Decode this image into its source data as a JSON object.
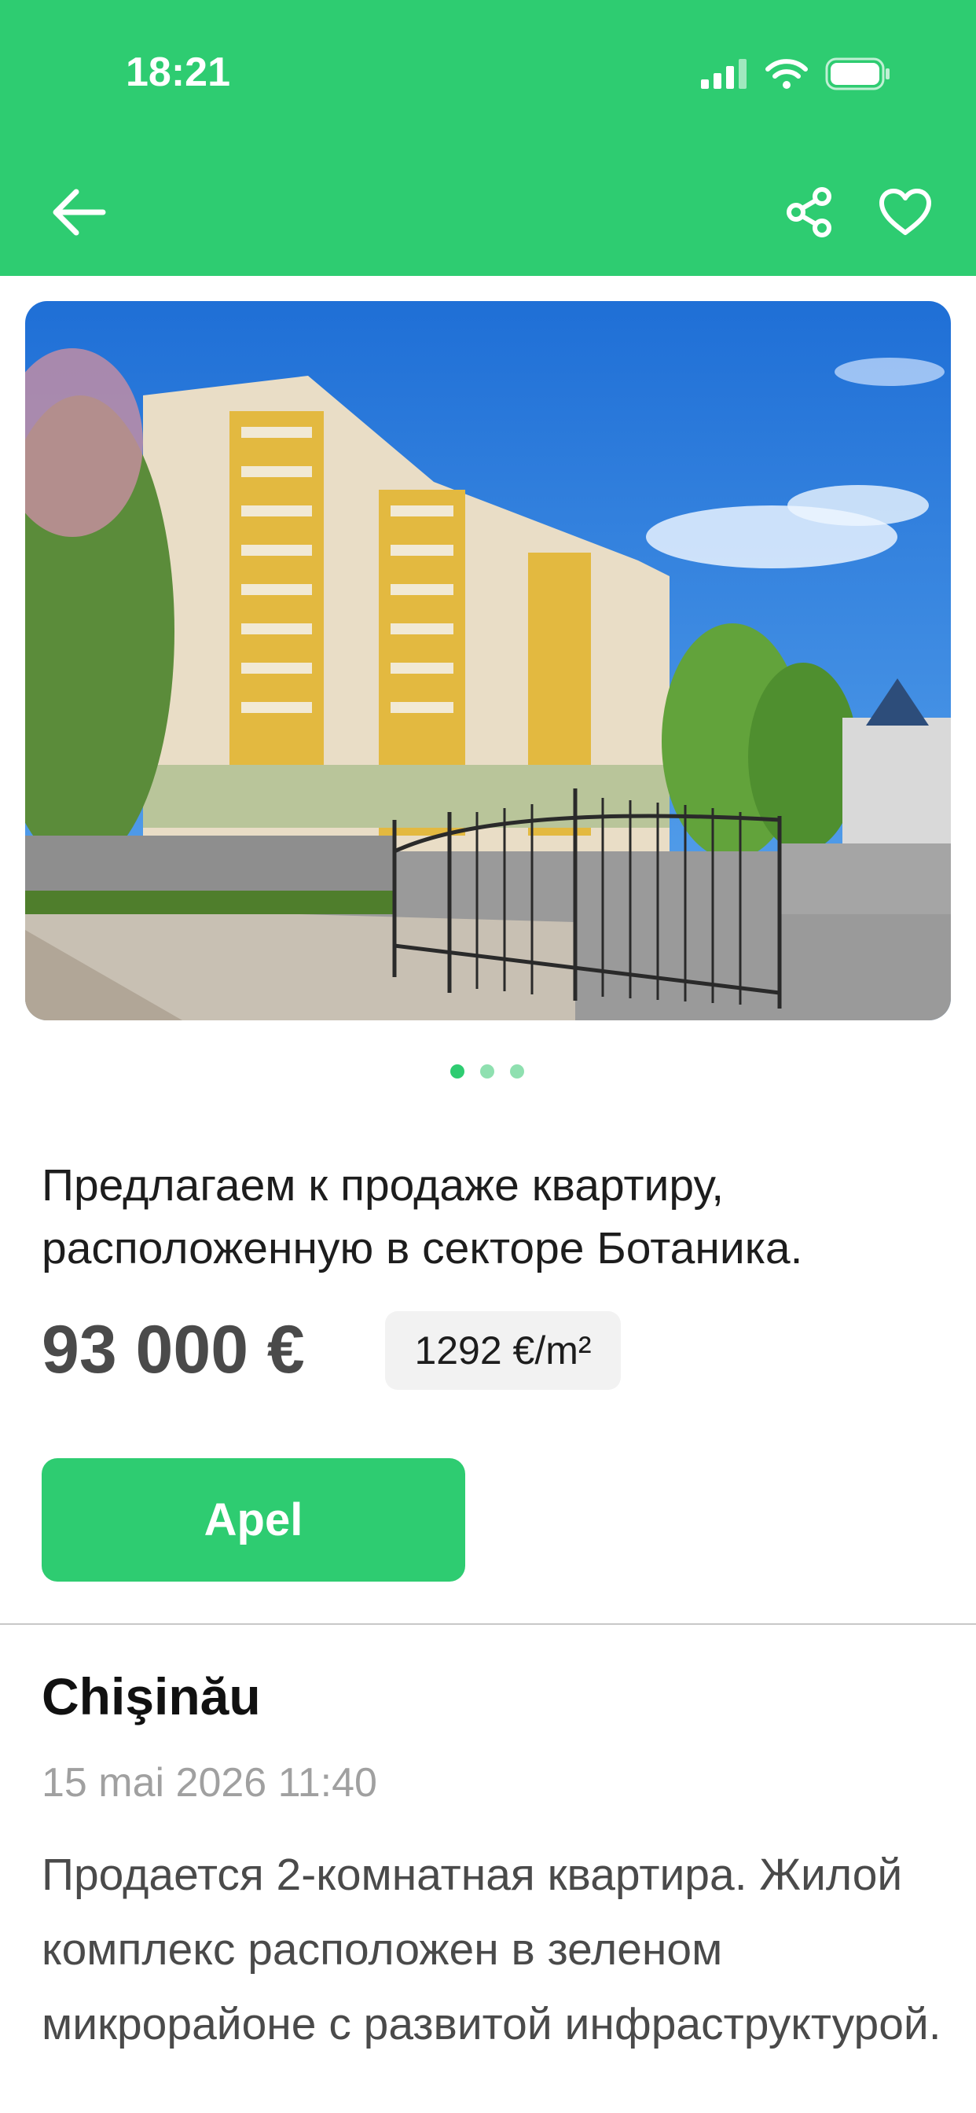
{
  "status_bar": {
    "time": "18:21"
  },
  "nav": {
    "back_icon": "arrow-left-icon",
    "share_icon": "share-icon",
    "favorite_icon": "heart-outline-icon"
  },
  "gallery": {
    "image_count": 3,
    "active_index": 0
  },
  "listing": {
    "title": "Предлагаем к продаже квартиру, расположенную в секторе Ботаника.",
    "price": "93 000 €",
    "price_per_m2": "1292 €/m²",
    "call_label": "Apel",
    "city": "Chişinău",
    "date": "15 mai 2026 11:40",
    "description": "Продается 2-комнатная квартира. Жилой комплекс расположен в зеленом микрорайоне с развитой инфраструктурой."
  },
  "colors": {
    "brand_green": "#2ecc71",
    "dot_inactive": "#8fe0b0"
  }
}
